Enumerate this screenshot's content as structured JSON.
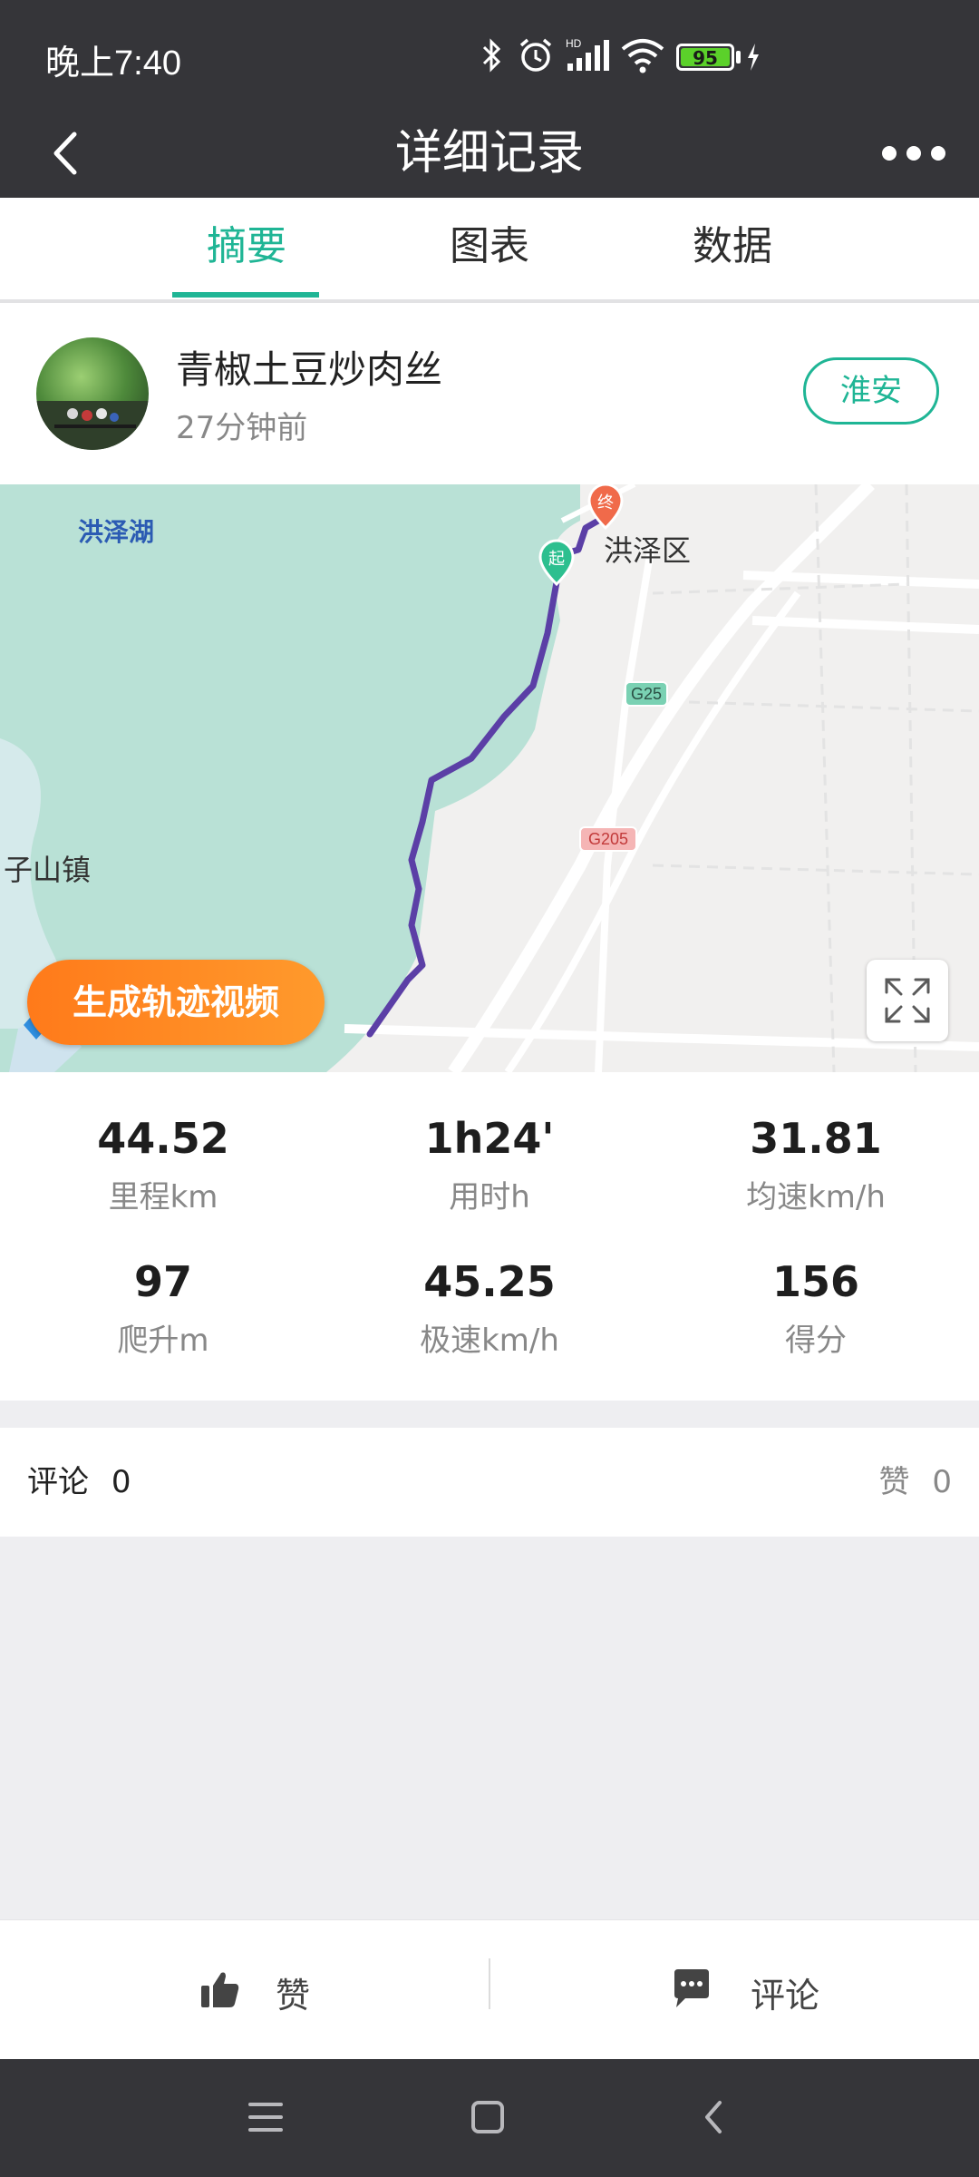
{
  "status_bar": {
    "time": "晚上7:40",
    "battery": "95",
    "network_label": "HD"
  },
  "header": {
    "title": "详细记录"
  },
  "tabs": [
    {
      "label": "摘要",
      "active": true
    },
    {
      "label": "图表",
      "active": false
    },
    {
      "label": "数据",
      "active": false
    }
  ],
  "user": {
    "name": "青椒土豆炒肉丝",
    "time_ago": "27分钟前",
    "city": "淮安"
  },
  "map": {
    "labels": {
      "lake": "洪泽湖",
      "district": "洪泽区",
      "town": "子山镇",
      "highway_g25": "G25",
      "highway_g205": "G205",
      "start_marker": "起",
      "end_marker": "终"
    },
    "generate_video_label": "生成轨迹视频",
    "route_color": "#5b3fa6"
  },
  "stats": [
    {
      "value": "44.52",
      "label": "里程km"
    },
    {
      "value": "1h24'",
      "label": "用时h"
    },
    {
      "value": "31.81",
      "label": "均速km/h"
    },
    {
      "value": "97",
      "label": "爬升m"
    },
    {
      "value": "45.25",
      "label": "极速km/h"
    },
    {
      "value": "156",
      "label": "得分"
    }
  ],
  "social": {
    "comments_label": "评论",
    "comments_count": "0",
    "likes_label": "赞",
    "likes_count": "0"
  },
  "bottom_bar": {
    "like_label": "赞",
    "comment_label": "评论"
  },
  "colors": {
    "accent": "#1fb595",
    "dark_bar": "#353539",
    "orange": "#ff7a1a"
  }
}
